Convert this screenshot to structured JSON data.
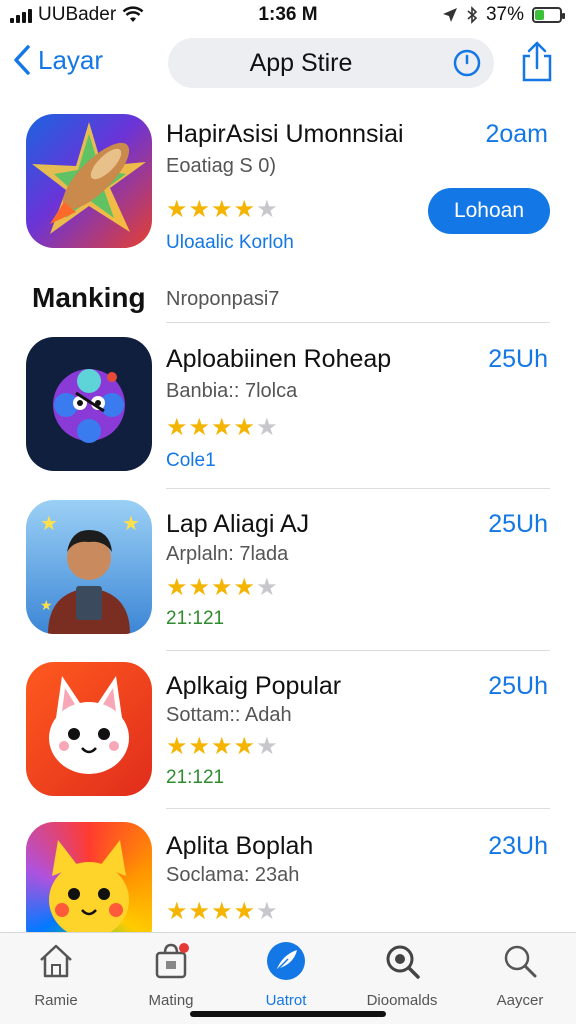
{
  "status_bar": {
    "carrier": "UUBader",
    "time": "1:36 M",
    "battery_percent": "37%",
    "battery_level": 0.37
  },
  "nav": {
    "back_label": "Layar",
    "title": "App Stire",
    "icons": [
      "chevron-left-icon",
      "clock-icon",
      "share-icon"
    ]
  },
  "featured": {
    "name": "HapirAsisi Umonnsiai",
    "subtitle": "Eoatiag S 0)",
    "meta": "Uloaalic Korloh",
    "size": "2oam",
    "get_label": "Lohoan",
    "rating": 4
  },
  "section": {
    "title": "Manking",
    "subtitle": "Nroponpasi7"
  },
  "apps": [
    {
      "name": "Aploabiinen Roheap",
      "subtitle": "Banbia:: 7lolca",
      "meta": "Cole1",
      "size": "25Uh",
      "rating": 4
    },
    {
      "name": "Lap Aliagi AJ",
      "subtitle": "Arplaln: 7lada",
      "meta": "21:121",
      "size": "25Uh",
      "rating": 4
    },
    {
      "name": "Aplkaig Popular",
      "subtitle": "Sottam:: Adah",
      "meta": "21:121",
      "size": "25Uh",
      "rating": 4
    },
    {
      "name": "Aplita Boplah",
      "subtitle": "Soclama: 23ah",
      "meta": "",
      "size": "23Uh",
      "rating": 4
    }
  ],
  "tabs": [
    {
      "label": "Ramie",
      "icon": "house-icon",
      "active": false
    },
    {
      "label": "Mating",
      "icon": "bag-icon",
      "active": false
    },
    {
      "label": "Uatrot",
      "icon": "feather-icon",
      "active": true
    },
    {
      "label": "Dioomalds",
      "icon": "magnifier-icon",
      "active": false
    },
    {
      "label": "Aaycer",
      "icon": "search-icon",
      "active": false
    }
  ],
  "colors": {
    "accent": "#1477e6",
    "star": "#f4b400",
    "meta_green": "#2e8b2e"
  }
}
